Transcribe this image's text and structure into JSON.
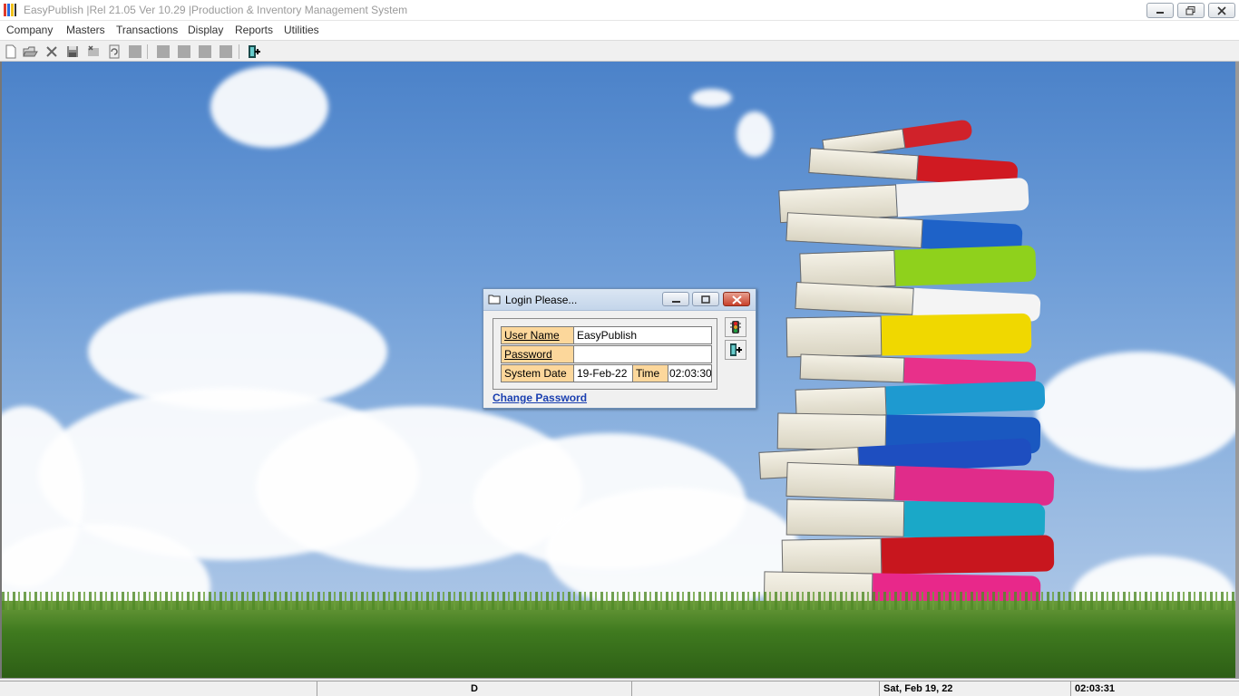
{
  "window": {
    "title": "EasyPublish |Rel 21.05 Ver 10.29 |Production & Inventory Management System"
  },
  "menu": {
    "items": [
      "Company",
      "Masters",
      "Transactions",
      "Display",
      "Reports",
      "Utilities"
    ]
  },
  "toolbar": {
    "buttons": [
      "new-icon",
      "open-icon",
      "delete-icon",
      "save-icon",
      "cancel-icon",
      "refresh-icon",
      "blank-icon",
      "first-icon",
      "previous-icon",
      "next-icon",
      "last-icon",
      "exit-icon"
    ]
  },
  "login": {
    "title": "Login Please...",
    "user_name_label": "User Name",
    "user_name_value": "EasyPublish",
    "password_label": "Password",
    "password_value": "",
    "system_date_label": "System Date",
    "system_date_value": "19-Feb-22",
    "time_label": "Time",
    "time_value": "02:03:30",
    "change_password": "Change Password"
  },
  "statusbar": {
    "pane1": "",
    "pane2": "D",
    "pane3": "",
    "date": "Sat, Feb 19, 22",
    "time": "02:03:31"
  },
  "colors": {
    "label_bg": "#fcd79b",
    "link": "#1a3fb0",
    "close_button": "#c8402a"
  }
}
